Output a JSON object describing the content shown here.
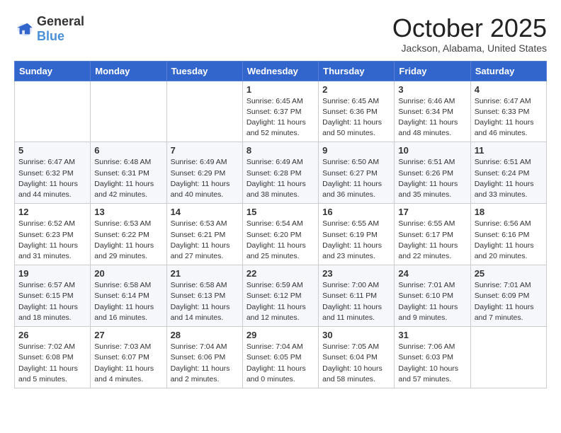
{
  "header": {
    "logo": {
      "general": "General",
      "blue": "Blue"
    },
    "title": "October 2025",
    "location": "Jackson, Alabama, United States"
  },
  "weekdays": [
    "Sunday",
    "Monday",
    "Tuesday",
    "Wednesday",
    "Thursday",
    "Friday",
    "Saturday"
  ],
  "weeks": [
    [
      {
        "day": "",
        "info": ""
      },
      {
        "day": "",
        "info": ""
      },
      {
        "day": "",
        "info": ""
      },
      {
        "day": "1",
        "info": "Sunrise: 6:45 AM\nSunset: 6:37 PM\nDaylight: 11 hours\nand 52 minutes."
      },
      {
        "day": "2",
        "info": "Sunrise: 6:45 AM\nSunset: 6:36 PM\nDaylight: 11 hours\nand 50 minutes."
      },
      {
        "day": "3",
        "info": "Sunrise: 6:46 AM\nSunset: 6:34 PM\nDaylight: 11 hours\nand 48 minutes."
      },
      {
        "day": "4",
        "info": "Sunrise: 6:47 AM\nSunset: 6:33 PM\nDaylight: 11 hours\nand 46 minutes."
      }
    ],
    [
      {
        "day": "5",
        "info": "Sunrise: 6:47 AM\nSunset: 6:32 PM\nDaylight: 11 hours\nand 44 minutes."
      },
      {
        "day": "6",
        "info": "Sunrise: 6:48 AM\nSunset: 6:31 PM\nDaylight: 11 hours\nand 42 minutes."
      },
      {
        "day": "7",
        "info": "Sunrise: 6:49 AM\nSunset: 6:29 PM\nDaylight: 11 hours\nand 40 minutes."
      },
      {
        "day": "8",
        "info": "Sunrise: 6:49 AM\nSunset: 6:28 PM\nDaylight: 11 hours\nand 38 minutes."
      },
      {
        "day": "9",
        "info": "Sunrise: 6:50 AM\nSunset: 6:27 PM\nDaylight: 11 hours\nand 36 minutes."
      },
      {
        "day": "10",
        "info": "Sunrise: 6:51 AM\nSunset: 6:26 PM\nDaylight: 11 hours\nand 35 minutes."
      },
      {
        "day": "11",
        "info": "Sunrise: 6:51 AM\nSunset: 6:24 PM\nDaylight: 11 hours\nand 33 minutes."
      }
    ],
    [
      {
        "day": "12",
        "info": "Sunrise: 6:52 AM\nSunset: 6:23 PM\nDaylight: 11 hours\nand 31 minutes."
      },
      {
        "day": "13",
        "info": "Sunrise: 6:53 AM\nSunset: 6:22 PM\nDaylight: 11 hours\nand 29 minutes."
      },
      {
        "day": "14",
        "info": "Sunrise: 6:53 AM\nSunset: 6:21 PM\nDaylight: 11 hours\nand 27 minutes."
      },
      {
        "day": "15",
        "info": "Sunrise: 6:54 AM\nSunset: 6:20 PM\nDaylight: 11 hours\nand 25 minutes."
      },
      {
        "day": "16",
        "info": "Sunrise: 6:55 AM\nSunset: 6:19 PM\nDaylight: 11 hours\nand 23 minutes."
      },
      {
        "day": "17",
        "info": "Sunrise: 6:55 AM\nSunset: 6:17 PM\nDaylight: 11 hours\nand 22 minutes."
      },
      {
        "day": "18",
        "info": "Sunrise: 6:56 AM\nSunset: 6:16 PM\nDaylight: 11 hours\nand 20 minutes."
      }
    ],
    [
      {
        "day": "19",
        "info": "Sunrise: 6:57 AM\nSunset: 6:15 PM\nDaylight: 11 hours\nand 18 minutes."
      },
      {
        "day": "20",
        "info": "Sunrise: 6:58 AM\nSunset: 6:14 PM\nDaylight: 11 hours\nand 16 minutes."
      },
      {
        "day": "21",
        "info": "Sunrise: 6:58 AM\nSunset: 6:13 PM\nDaylight: 11 hours\nand 14 minutes."
      },
      {
        "day": "22",
        "info": "Sunrise: 6:59 AM\nSunset: 6:12 PM\nDaylight: 11 hours\nand 12 minutes."
      },
      {
        "day": "23",
        "info": "Sunrise: 7:00 AM\nSunset: 6:11 PM\nDaylight: 11 hours\nand 11 minutes."
      },
      {
        "day": "24",
        "info": "Sunrise: 7:01 AM\nSunset: 6:10 PM\nDaylight: 11 hours\nand 9 minutes."
      },
      {
        "day": "25",
        "info": "Sunrise: 7:01 AM\nSunset: 6:09 PM\nDaylight: 11 hours\nand 7 minutes."
      }
    ],
    [
      {
        "day": "26",
        "info": "Sunrise: 7:02 AM\nSunset: 6:08 PM\nDaylight: 11 hours\nand 5 minutes."
      },
      {
        "day": "27",
        "info": "Sunrise: 7:03 AM\nSunset: 6:07 PM\nDaylight: 11 hours\nand 4 minutes."
      },
      {
        "day": "28",
        "info": "Sunrise: 7:04 AM\nSunset: 6:06 PM\nDaylight: 11 hours\nand 2 minutes."
      },
      {
        "day": "29",
        "info": "Sunrise: 7:04 AM\nSunset: 6:05 PM\nDaylight: 11 hours\nand 0 minutes."
      },
      {
        "day": "30",
        "info": "Sunrise: 7:05 AM\nSunset: 6:04 PM\nDaylight: 10 hours\nand 58 minutes."
      },
      {
        "day": "31",
        "info": "Sunrise: 7:06 AM\nSunset: 6:03 PM\nDaylight: 10 hours\nand 57 minutes."
      },
      {
        "day": "",
        "info": ""
      }
    ]
  ]
}
